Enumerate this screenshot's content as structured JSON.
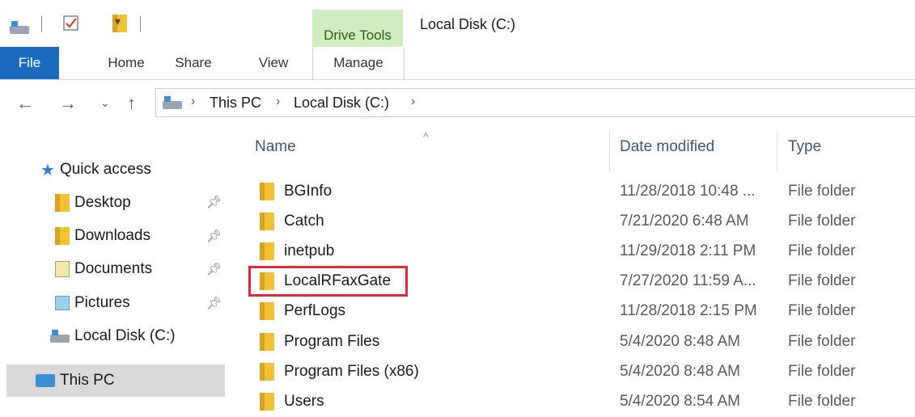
{
  "window": {
    "title": "Local Disk (C:)",
    "contextual_tab_group": "Drive Tools"
  },
  "quick_access_toolbar": {
    "icons": [
      "drive-icon",
      "properties-checkbox-icon",
      "new-folder-icon",
      "customize-dropdown-icon"
    ]
  },
  "ribbon": {
    "tabs": [
      "File",
      "Home",
      "Share",
      "View",
      "Manage"
    ],
    "active_tab": "File",
    "colors": {
      "file_tab": "#1a6bbf",
      "drive_tools": "#cfeec0"
    }
  },
  "address_bar": {
    "breadcrumbs": [
      "This PC",
      "Local Disk (C:)"
    ]
  },
  "nav_pane": {
    "quick_access_label": "Quick access",
    "items": [
      {
        "label": "Desktop",
        "icon": "desktop-folder-icon",
        "pinned": true
      },
      {
        "label": "Downloads",
        "icon": "downloads-folder-icon",
        "pinned": true
      },
      {
        "label": "Documents",
        "icon": "documents-folder-icon",
        "pinned": true
      },
      {
        "label": "Pictures",
        "icon": "pictures-folder-icon",
        "pinned": true
      },
      {
        "label": "Local Disk (C:)",
        "icon": "drive-icon",
        "pinned": false
      }
    ],
    "this_pc_label": "This PC",
    "selected": "This PC"
  },
  "file_list": {
    "columns": [
      "Name",
      "Date modified",
      "Type"
    ],
    "sort_column": "Name",
    "rows": [
      {
        "name": "BGInfo",
        "date": "11/28/2018 10:48 ...",
        "type": "File folder"
      },
      {
        "name": "Catch",
        "date": "7/21/2020 6:48 AM",
        "type": "File folder"
      },
      {
        "name": "inetpub",
        "date": "11/29/2018 2:11 PM",
        "type": "File folder"
      },
      {
        "name": "LocalRFaxGate",
        "date": "7/27/2020 11:59 A...",
        "type": "File folder",
        "highlighted": true
      },
      {
        "name": "PerfLogs",
        "date": "11/28/2018 2:15 PM",
        "type": "File folder"
      },
      {
        "name": "Program Files",
        "date": "5/4/2020 8:48 AM",
        "type": "File folder"
      },
      {
        "name": "Program Files (x86)",
        "date": "5/4/2020 8:48 AM",
        "type": "File folder"
      },
      {
        "name": "Users",
        "date": "5/4/2020 8:54 AM",
        "type": "File folder"
      }
    ],
    "highlight_color": "#e0283a"
  }
}
